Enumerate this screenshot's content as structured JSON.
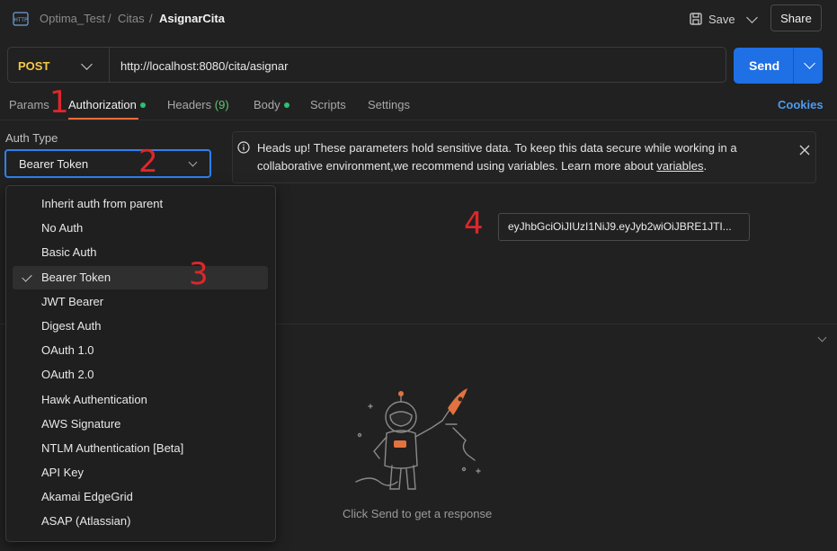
{
  "header": {
    "icon_name": "http-icon",
    "breadcrumb": [
      "Optima_Test",
      "Citas",
      "AsignarCita"
    ],
    "separator": "/",
    "save_label": "Save",
    "share_label": "Share"
  },
  "request": {
    "method": "POST",
    "url": "http://localhost:8080/cita/asignar",
    "send_label": "Send"
  },
  "tabs": {
    "items": [
      {
        "label": "Params"
      },
      {
        "label": "Authorization"
      },
      {
        "label": "Headers",
        "count": "(9)"
      },
      {
        "label": "Body"
      },
      {
        "label": "Scripts"
      },
      {
        "label": "Settings"
      }
    ],
    "active": "Authorization",
    "cookies_label": "Cookies"
  },
  "auth": {
    "type_label": "Auth Type",
    "selected": "Bearer Token",
    "options": [
      "Inherit auth from parent",
      "No Auth",
      "Basic Auth",
      "Bearer Token",
      "JWT Bearer",
      "Digest Auth",
      "OAuth 1.0",
      "OAuth 2.0",
      "Hawk Authentication",
      "AWS Signature",
      "NTLM Authentication [Beta]",
      "API Key",
      "Akamai EdgeGrid",
      "ASAP (Atlassian)"
    ],
    "token_value": "eyJhbGciOiJIUzI1NiJ9.eyJyb2wiOiJBRE1JTI..."
  },
  "alert": {
    "text_line1": "Heads up! These parameters hold sensitive data. To keep this data secure while working in a",
    "text_line2_prefix": "collaborative environment,we recommend using variables. Learn more about",
    "link_text": "variables",
    "text_suffix": "."
  },
  "response": {
    "empty_message": "Click Send to get a response"
  },
  "annotations": [
    "1",
    "2",
    "3",
    "4"
  ],
  "colors": {
    "accent_blue": "#1f6fe5",
    "method_post": "#f7c748",
    "tab_underline": "#f26b3a",
    "status_dot": "#2fbf71",
    "annotation_red": "#e0262a"
  }
}
